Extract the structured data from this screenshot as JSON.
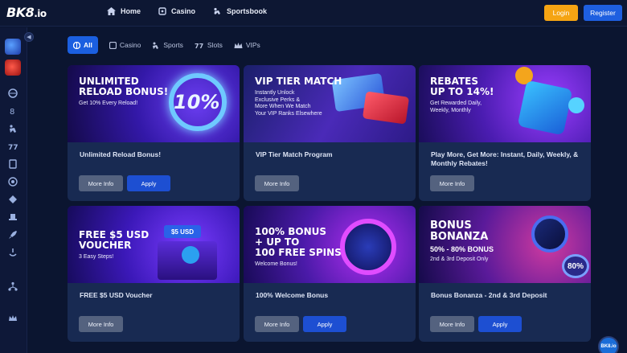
{
  "header": {
    "logo": "BK8",
    "logo_suffix": ".io",
    "nav": [
      {
        "label": "Home",
        "icon": "home-icon"
      },
      {
        "label": "Casino",
        "icon": "casino-icon"
      },
      {
        "label": "Sportsbook",
        "icon": "sportsbook-icon"
      }
    ],
    "login_label": "Login",
    "register_label": "Register"
  },
  "tabs": [
    {
      "label": "All",
      "active": true
    },
    {
      "label": "Casino",
      "active": false
    },
    {
      "label": "Sports",
      "active": false
    },
    {
      "label": "Slots",
      "active": false
    },
    {
      "label": "VIPs",
      "active": false
    }
  ],
  "cards": [
    {
      "banner_title": "UNLIMITED\nRELOAD BONUS!",
      "banner_sub": "Get 10% Every Reload!",
      "badge": "10%",
      "title": "Unlimited Reload Bonus!",
      "more": "More Info",
      "apply": "Apply"
    },
    {
      "banner_title": "VIP TIER MATCH",
      "banner_sub": "Instantly Unlock\nExclusive Perks &\nMore When We Match\nYour VIP Ranks Elsewhere",
      "title": "VIP Tier Match Program",
      "more": "More Info"
    },
    {
      "banner_title": "REBATES\nUP TO 14%!",
      "banner_sub": "Get Rewarded Daily,\nWeekly, Monthly",
      "title": "Play More, Get More: Instant, Daily, Weekly, & Monthly Rebates!",
      "more": "More Info"
    },
    {
      "banner_title": "FREE $5 USD\nVOUCHER",
      "banner_sub": "3 Easy Steps!",
      "badge": "$5 USD",
      "title": "FREE $5 USD Voucher",
      "more": "More Info"
    },
    {
      "banner_title": "100% BONUS\n+ UP TO\n100 FREE SPINS",
      "banner_sub": "Welcome Bonus!",
      "title": "100% Welcome Bonus",
      "more": "More Info",
      "apply": "Apply"
    },
    {
      "banner_title": "BONUS\nBONANZA",
      "banner_sub": "2nd & 3rd Deposit Only",
      "banner_extra": "50% - 80% BONUS",
      "badge": "80%",
      "title": "Bonus Bonanza - 2nd & 3rd Deposit",
      "more": "More Info",
      "apply": "Apply"
    }
  ],
  "colors": {
    "accent": "#1b5fe0",
    "login": "#f5a413",
    "card": "#182a52",
    "background": "#0b1530"
  }
}
